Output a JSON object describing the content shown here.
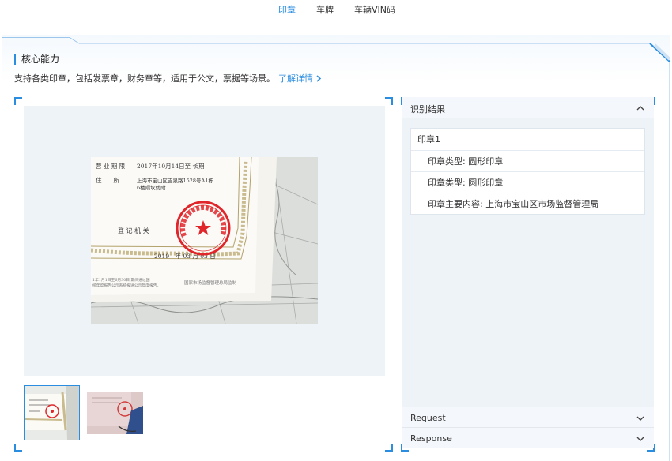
{
  "tabs": [
    {
      "label": "印章",
      "active": true
    },
    {
      "label": "车牌",
      "active": false
    },
    {
      "label": "车辆VIN码",
      "active": false
    }
  ],
  "section": {
    "title": "核心能力",
    "description": "支持各类印章，包括发票章，财务章等，适用于公文，票据等场景。",
    "more_link": "了解详情",
    "more_icon": "chevron-right-icon"
  },
  "photo": {
    "doc_label_1": "营 业 期 限",
    "doc_value_1": "2017年10月14日至 长期",
    "doc_label_2": "住　　所",
    "doc_value_2": "上海市宝山区吉泉路1528号A1栋",
    "doc_value_2b": "6楼隔坎优附",
    "doc_label_3": "登 记 机 关",
    "doc_date": "2019　年 03 月 03 日",
    "seal_text": "上海市宝山区市场监督管理局",
    "footer_left_1": "1年1月1日至6月30日 期间通过国",
    "footer_left_2": "统年度报告公示系统报送公示年度报告。",
    "footer_right": "国家市场监督管理总局监制"
  },
  "thumbnails": [
    {
      "name": "thumbnail-certificate",
      "active": true
    },
    {
      "name": "thumbnail-red-seal",
      "active": false
    }
  ],
  "result": {
    "header": "识别结果",
    "seal_title": "印章1",
    "rows": [
      "印章类型: 圆形印章",
      "印章类型: 圆形印章",
      "印章主要内容: 上海市宝山区市场监督管理局"
    ]
  },
  "request_label": "Request",
  "response_label": "Response",
  "colors": {
    "accent": "#2a8de0",
    "panel_bg": "#eef3f8",
    "seal_red": "#e0262a"
  }
}
